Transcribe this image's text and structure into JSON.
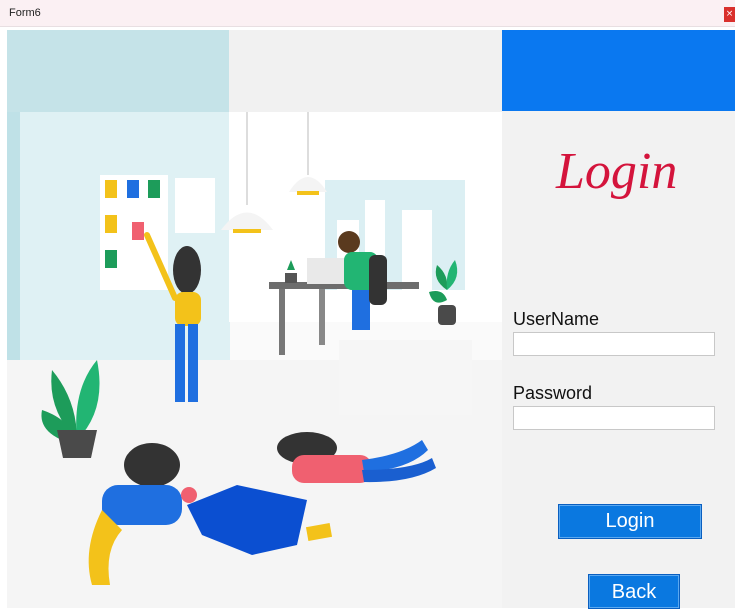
{
  "window": {
    "title": "Form6",
    "close_label": "×"
  },
  "login": {
    "heading": "Login",
    "username_label": "UserName",
    "username_value": "",
    "password_label": "Password",
    "password_value": "",
    "login_button": "Login",
    "back_button": "Back"
  },
  "colors": {
    "accent_blue": "#0a78f0",
    "heading_red": "#d4143c",
    "panel_bg": "#f2f2f2"
  },
  "icons": [
    "close-icon"
  ]
}
